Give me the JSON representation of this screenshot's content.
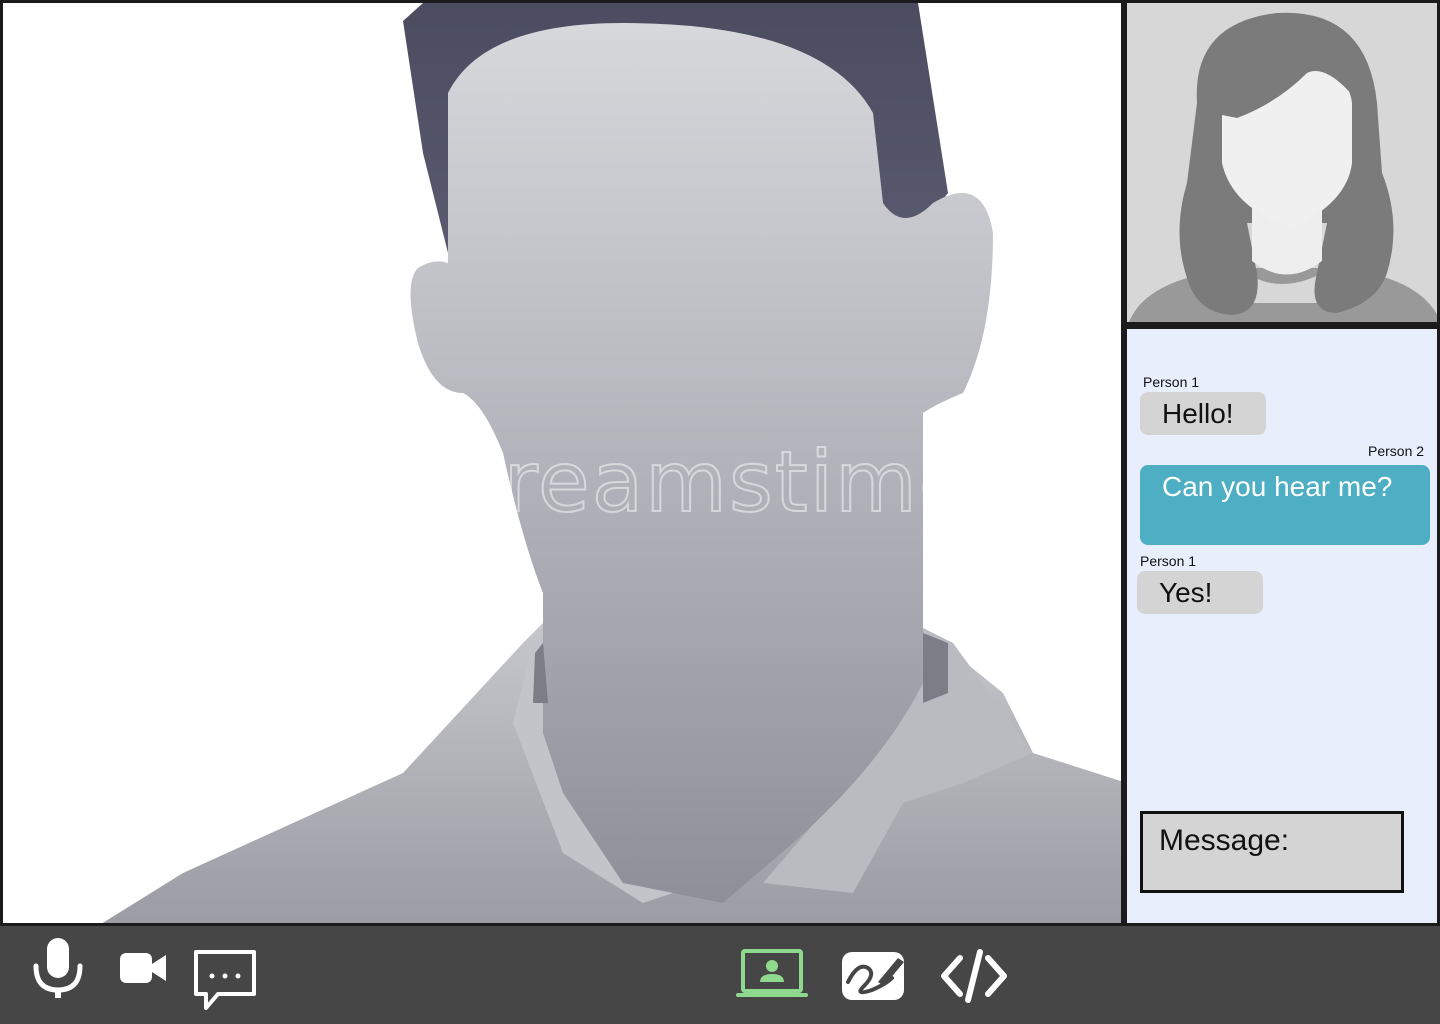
{
  "main_video": {
    "participant_image": "male-avatar-silhouette",
    "watermark": "dreamstime"
  },
  "pip_video": {
    "participant_image": "female-avatar-silhouette"
  },
  "chat": {
    "messages": [
      {
        "sender": "Person 1",
        "text": "Hello!",
        "side": "left"
      },
      {
        "sender": "Person 2",
        "text": "Can you hear me?",
        "side": "right"
      },
      {
        "sender": "Person 1",
        "text": "Yes!",
        "side": "left"
      }
    ],
    "input_placeholder": "Message:"
  },
  "toolbar": {
    "left_buttons": [
      {
        "icon": "microphone-icon"
      },
      {
        "icon": "video-camera-icon"
      },
      {
        "icon": "chat-bubble-icon"
      }
    ],
    "center_buttons": [
      {
        "icon": "screen-share-icon",
        "active": true
      },
      {
        "icon": "whiteboard-icon"
      },
      {
        "icon": "code-icon"
      }
    ]
  },
  "colors": {
    "toolbar_bg": "#464646",
    "chat_bg": "#e8eefc",
    "my_bubble": "#4eaec4",
    "their_bubble": "#d4d4d4",
    "active_icon": "#8fd98f"
  }
}
